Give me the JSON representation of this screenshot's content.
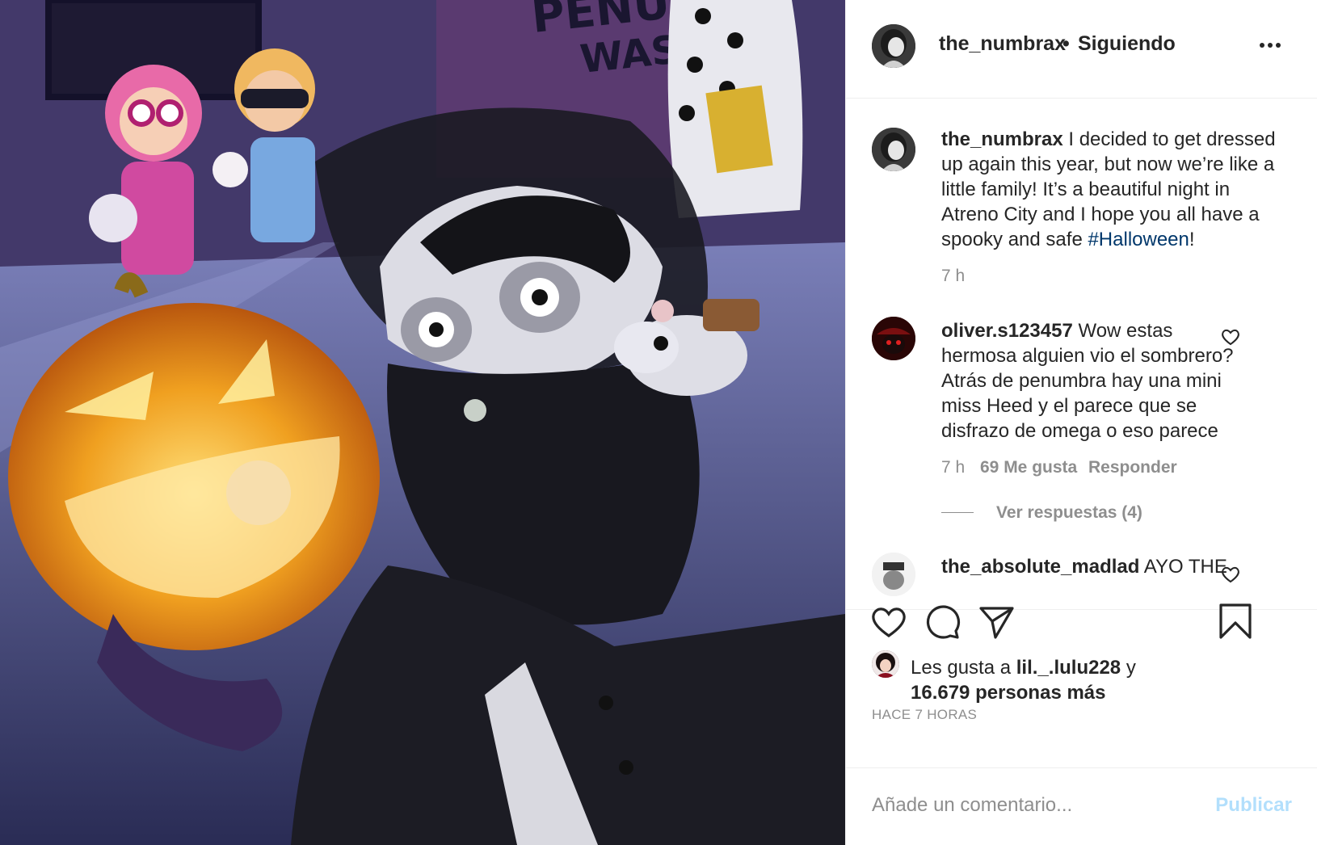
{
  "header": {
    "username": "the_numbrax",
    "separator": "•",
    "follow_status": "Siguiendo"
  },
  "caption": {
    "username": "the_numbrax",
    "text": "I decided to get dressed up again this year, but now we’re like a little family! It’s a beautiful night in Atreno City and I hope you all have a spooky and safe ",
    "hashtag": "#Halloween",
    "end": "!",
    "time": "7 h"
  },
  "comments": [
    {
      "username": "oliver.s123457",
      "text": "Wow estas hermosa alguien vio el sombrero? Atrás de penumbra hay una mini miss Heed y el parece que se disfrazo de omega o eso parece",
      "time": "7 h",
      "likes": "69 Me gusta",
      "reply": "Responder",
      "view_replies": "Ver respuestas (4)"
    },
    {
      "username": "the_absolute_madlad",
      "text": "AYO THE"
    }
  ],
  "likes": {
    "prefix": "Les gusta a ",
    "user": "lil._.lulu228",
    "connector": " y",
    "others": "16.679 personas más"
  },
  "timestamp": "HACE 7 HORAS",
  "add_comment": {
    "placeholder": "Añade un comentario...",
    "publish": "Publicar"
  },
  "artwork_text": [
    "PENUM",
    "WAS"
  ],
  "icons": [
    "more-icon",
    "heart-icon",
    "comment-icon",
    "share-icon",
    "bookmark-icon"
  ],
  "colors": {
    "link": "#00376b",
    "publish_disabled": "#b2dffc",
    "muted": "#8e8e8e",
    "text": "#262626"
  }
}
